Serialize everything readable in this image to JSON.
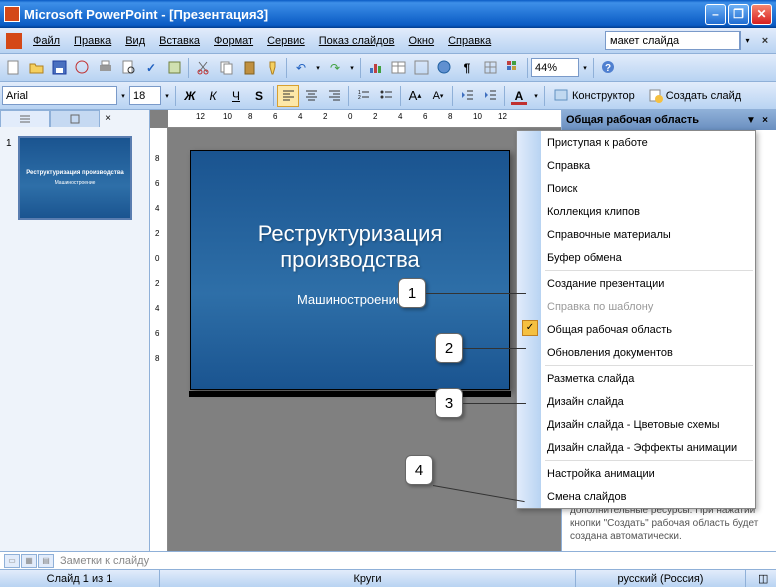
{
  "window": {
    "title": "Microsoft PowerPoint - [Презентация3]"
  },
  "menu": {
    "items": [
      "Файл",
      "Правка",
      "Вид",
      "Вставка",
      "Формат",
      "Сервис",
      "Показ слайдов",
      "Окно",
      "Справка"
    ],
    "layout_box": "макет слайда"
  },
  "toolbar": {
    "zoom": "44%"
  },
  "format": {
    "font": "Arial",
    "size": "18",
    "designer": "Конструктор",
    "new_slide": "Создать слайд"
  },
  "ruler": {
    "h": [
      "12",
      "10",
      "8",
      "6",
      "4",
      "2",
      "0",
      "2",
      "4",
      "6",
      "8",
      "10",
      "12"
    ],
    "v": [
      "8",
      "6",
      "4",
      "2",
      "0",
      "2",
      "4",
      "6",
      "8"
    ]
  },
  "thumbs": {
    "num": "1",
    "title": "Реструктуризация производства",
    "sub": "Машиностроение"
  },
  "slide": {
    "title_line1": "Реструктуризация",
    "title_line2": "производства",
    "subtitle": "Машиностроение"
  },
  "taskpane": {
    "title": "Общая рабочая область",
    "footer": "дополнительные ресурсы. При нажатии кнопки \"Создать\" рабочая область будет создана автоматически."
  },
  "dropdown": {
    "items": [
      {
        "label": "Приступая к работе",
        "sep": false
      },
      {
        "label": "Справка",
        "sep": false
      },
      {
        "label": "Поиск",
        "sep": false
      },
      {
        "label": "Коллекция клипов",
        "sep": false
      },
      {
        "label": "Справочные материалы",
        "sep": false
      },
      {
        "label": "Буфер обмена",
        "sep": true
      },
      {
        "label": "Создание презентации",
        "sep": false
      },
      {
        "label": "Справка по шаблону",
        "disabled": true,
        "sep": false
      },
      {
        "label": "Общая рабочая область",
        "checked": true,
        "sep": false
      },
      {
        "label": "Обновления документов",
        "sep": true
      },
      {
        "label": "Разметка слайда",
        "sep": false
      },
      {
        "label": "Дизайн слайда",
        "sep": false
      },
      {
        "label": "Дизайн слайда - Цветовые схемы",
        "sep": false
      },
      {
        "label": "Дизайн слайда - Эффекты анимации",
        "sep": true
      },
      {
        "label": "Настройка анимации",
        "sep": false
      },
      {
        "label": "Смена слайдов",
        "sep": false
      }
    ]
  },
  "callouts": [
    "1",
    "2",
    "3",
    "4"
  ],
  "notes": {
    "placeholder": "Заметки к слайду"
  },
  "status": {
    "slide": "Слайд 1 из 1",
    "theme": "Круги",
    "lang": "русский (Россия)"
  }
}
